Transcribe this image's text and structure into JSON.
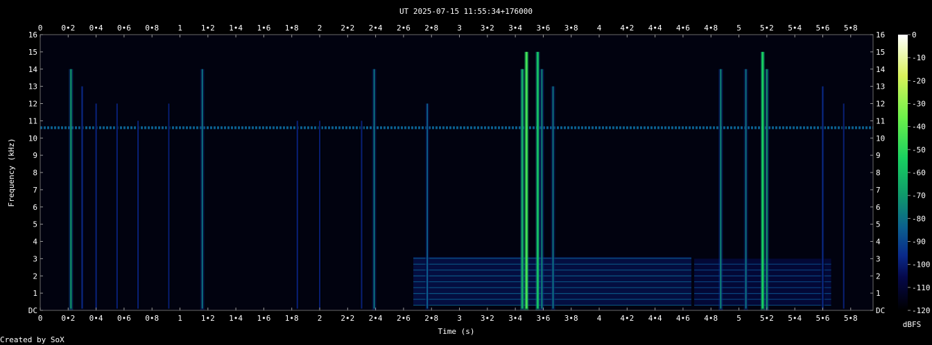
{
  "chart_data": {
    "type": "heatmap",
    "title": "UT 2025-07-15 11:55:34+176000",
    "xlabel": "Time (s)",
    "ylabel": "Frequency (kHz)",
    "xlim": [
      0,
      5.96
    ],
    "ylim": [
      0,
      16
    ],
    "x_ticks": [
      "0",
      "0•2",
      "0•4",
      "0•6",
      "0•8",
      "1",
      "1•2",
      "1•4",
      "1•6",
      "1•8",
      "2",
      "2•2",
      "2•4",
      "2•6",
      "2•8",
      "3",
      "3•2",
      "3•4",
      "3•6",
      "3•8",
      "4",
      "4•2",
      "4•4",
      "4•6",
      "4•8",
      "5",
      "5•2",
      "5•4",
      "5•6",
      "5•8"
    ],
    "y_ticks": [
      "DC",
      "1",
      "2",
      "3",
      "4",
      "5",
      "6",
      "7",
      "8",
      "9",
      "10",
      "11",
      "12",
      "13",
      "14",
      "15",
      "16"
    ],
    "colorbar": {
      "label": "dBFS",
      "ticks": [
        "0",
        "-10",
        "-20",
        "-30",
        "-40",
        "-50",
        "-60",
        "-70",
        "-80",
        "-90",
        "-100",
        "-110",
        "-120"
      ],
      "range": [
        -120,
        0
      ]
    },
    "features": {
      "tone_band_khz": 10.6,
      "tone_band_dbfs": -85,
      "clicks": [
        {
          "t": 0.22,
          "level_dbfs": -70,
          "top_khz": 14
        },
        {
          "t": 0.3,
          "level_dbfs": -95,
          "top_khz": 13
        },
        {
          "t": 0.4,
          "level_dbfs": -97,
          "top_khz": 12
        },
        {
          "t": 0.55,
          "level_dbfs": -98,
          "top_khz": 12
        },
        {
          "t": 0.7,
          "level_dbfs": -98,
          "top_khz": 11
        },
        {
          "t": 0.92,
          "level_dbfs": -99,
          "top_khz": 12
        },
        {
          "t": 1.16,
          "level_dbfs": -80,
          "top_khz": 14
        },
        {
          "t": 1.84,
          "level_dbfs": -98,
          "top_khz": 11
        },
        {
          "t": 2.0,
          "level_dbfs": -99,
          "top_khz": 11
        },
        {
          "t": 2.3,
          "level_dbfs": -98,
          "top_khz": 11
        },
        {
          "t": 2.39,
          "level_dbfs": -80,
          "top_khz": 14
        },
        {
          "t": 2.77,
          "level_dbfs": -85,
          "top_khz": 12
        },
        {
          "t": 3.45,
          "level_dbfs": -65,
          "top_khz": 14
        },
        {
          "t": 3.48,
          "level_dbfs": -45,
          "top_khz": 15
        },
        {
          "t": 3.56,
          "level_dbfs": -60,
          "top_khz": 15
        },
        {
          "t": 3.59,
          "level_dbfs": -75,
          "top_khz": 14
        },
        {
          "t": 3.67,
          "level_dbfs": -80,
          "top_khz": 13
        },
        {
          "t": 4.87,
          "level_dbfs": -75,
          "top_khz": 14
        },
        {
          "t": 5.05,
          "level_dbfs": -80,
          "top_khz": 14
        },
        {
          "t": 5.17,
          "level_dbfs": -55,
          "top_khz": 15
        },
        {
          "t": 5.2,
          "level_dbfs": -70,
          "top_khz": 14
        },
        {
          "t": 5.6,
          "level_dbfs": -95,
          "top_khz": 13
        },
        {
          "t": 5.75,
          "level_dbfs": -98,
          "top_khz": 12
        }
      ],
      "harmonic_blocks": [
        {
          "t_start": 2.67,
          "t_end": 4.66,
          "f_low_khz": 0.3,
          "f_high_khz": 3.1,
          "level_dbfs": -85
        },
        {
          "t_start": 4.68,
          "t_end": 5.66,
          "f_low_khz": 0.3,
          "f_high_khz": 3.0,
          "level_dbfs": -88
        }
      ]
    }
  },
  "footer": "Created by SoX"
}
